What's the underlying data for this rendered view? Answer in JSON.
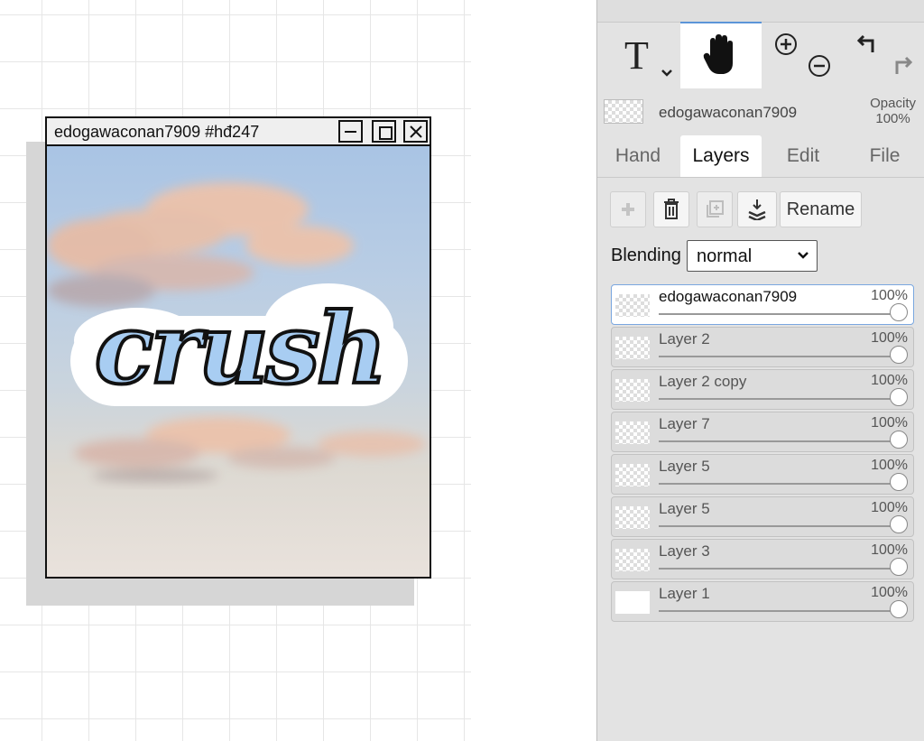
{
  "window": {
    "title": "edogawaconan7909   #hđ247",
    "artwork_text": "crush"
  },
  "panel": {
    "tools": [
      {
        "name": "text-tool",
        "glyph": "T"
      },
      {
        "name": "hand-tool",
        "active": true
      },
      {
        "name": "zoom-tool"
      },
      {
        "name": "undo-redo"
      }
    ],
    "current_layer": {
      "name": "edogawaconan7909",
      "opacity_label": "Opacity",
      "opacity_value": "100%"
    },
    "tabs": [
      "Hand",
      "Layers",
      "Edit",
      "File"
    ],
    "active_tab": "Layers",
    "actions": {
      "rename_label": "Rename"
    },
    "blending": {
      "label": "Blending",
      "value": "normal"
    },
    "layers": [
      {
        "name": "edogawaconan7909",
        "opacity": "100%",
        "active": true
      },
      {
        "name": "Layer 2",
        "opacity": "100%"
      },
      {
        "name": "Layer 2 copy",
        "opacity": "100%"
      },
      {
        "name": "Layer 7",
        "opacity": "100%"
      },
      {
        "name": "Layer 5",
        "opacity": "100%"
      },
      {
        "name": "Layer 5",
        "opacity": "100%"
      },
      {
        "name": "Layer 3",
        "opacity": "100%"
      },
      {
        "name": "Layer 1",
        "opacity": "100%"
      }
    ]
  },
  "colors": {
    "accent": "#5b95d8",
    "panel_bg": "#e3e3e3",
    "sky_top": "#a9c4e4",
    "cloud": "#f0c2a8",
    "lettering_blue": "#a8cdf2"
  }
}
